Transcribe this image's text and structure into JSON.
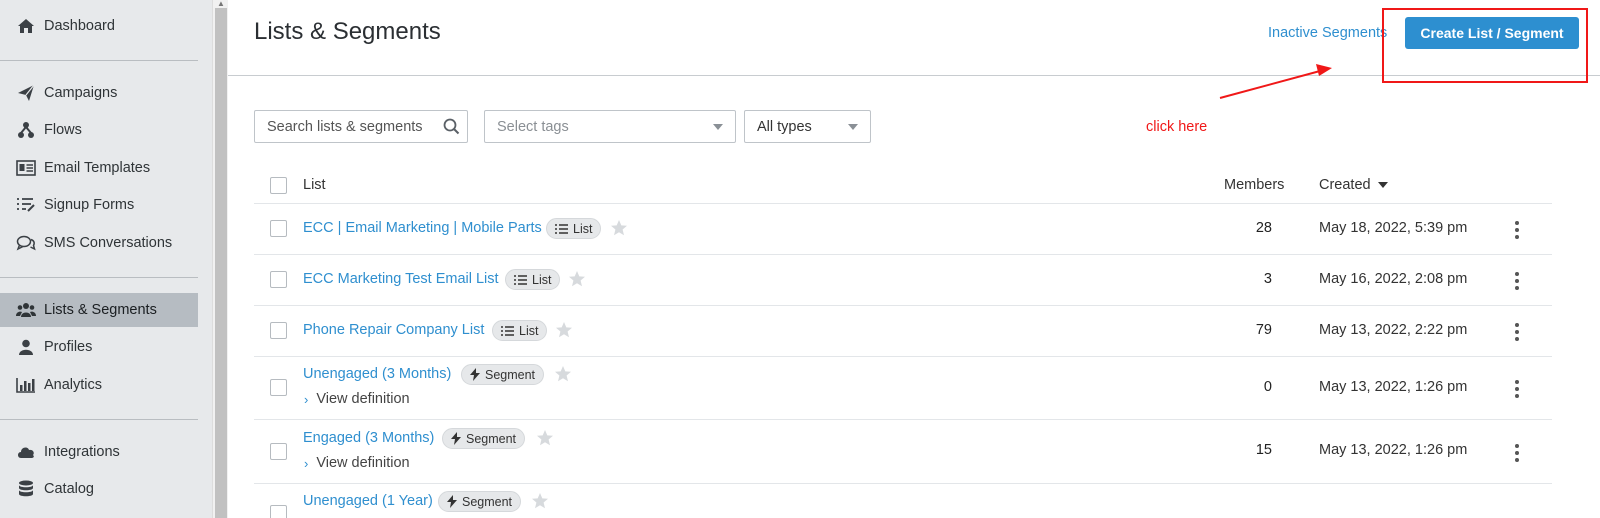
{
  "sidebar": {
    "items": [
      {
        "label": "Dashboard",
        "icon": "home-icon"
      },
      {
        "label": "Campaigns",
        "icon": "paper-plane-icon"
      },
      {
        "label": "Flows",
        "icon": "flows-icon"
      },
      {
        "label": "Email Templates",
        "icon": "email-template-icon"
      },
      {
        "label": "Signup Forms",
        "icon": "signup-forms-icon"
      },
      {
        "label": "SMS Conversations",
        "icon": "chat-icon"
      },
      {
        "label": "Lists & Segments",
        "icon": "users-icon",
        "active": true
      },
      {
        "label": "Profiles",
        "icon": "user-icon"
      },
      {
        "label": "Analytics",
        "icon": "bar-chart-icon"
      },
      {
        "label": "Integrations",
        "icon": "cloud-icon"
      },
      {
        "label": "Catalog",
        "icon": "database-icon"
      }
    ]
  },
  "header": {
    "title": "Lists & Segments",
    "inactive_link": "Inactive Segments",
    "create_button": "Create List / Segment"
  },
  "annotation": {
    "text": "click here",
    "color": "#f01818"
  },
  "filters": {
    "search_placeholder": "Search lists & segments",
    "tags_placeholder": "Select tags",
    "types_value": "All types"
  },
  "table": {
    "columns": {
      "list": "List",
      "members": "Members",
      "created": "Created"
    },
    "view_definition": "View definition",
    "rows": [
      {
        "name": "ECC | Email Marketing | Mobile Parts",
        "type": "List",
        "members": "28",
        "created": "May 18, 2022, 5:39 pm"
      },
      {
        "name": "ECC Marketing Test Email List",
        "type": "List",
        "members": "3",
        "created": "May 16, 2022, 2:08 pm"
      },
      {
        "name": "Phone Repair Company List",
        "type": "List",
        "members": "79",
        "created": "May 13, 2022, 2:22 pm"
      },
      {
        "name": "Unengaged (3 Months)",
        "type": "Segment",
        "members": "0",
        "created": "May 13, 2022, 1:26 pm"
      },
      {
        "name": "Engaged (3 Months)",
        "type": "Segment",
        "members": "15",
        "created": "May 13, 2022, 1:26 pm"
      },
      {
        "name": "Unengaged (1 Year)",
        "type": "Segment",
        "members": "",
        "created": ""
      }
    ]
  },
  "colors": {
    "accent": "#2d8fd0",
    "link": "#2f8fcf",
    "sidebar_bg": "#e7e9eb",
    "sidebar_active": "#b6bcc2"
  }
}
